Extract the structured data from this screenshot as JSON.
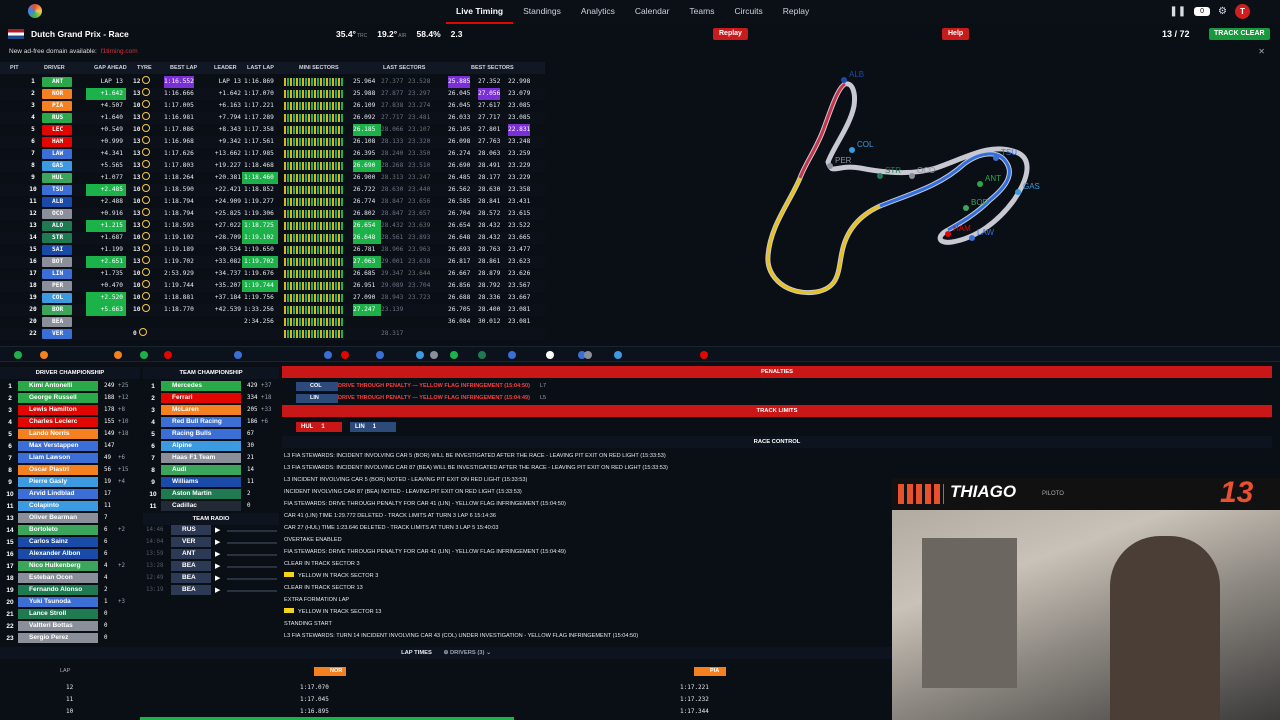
{
  "nav": {
    "items": [
      "Live Timing",
      "Standings",
      "Analytics",
      "Calendar",
      "Teams",
      "Circuits",
      "Replay"
    ],
    "active": "Live Timing"
  },
  "topright": {
    "notif_count": "0",
    "avatar": "T"
  },
  "race": {
    "title": "Dutch Grand Prix - Race",
    "track_temp": "35.4°",
    "air_temp": "19.2°",
    "humidity": "58.4%",
    "wind": "2.3",
    "replay_badge": "Replay",
    "help_badge": "Help",
    "lap_current": "13",
    "lap_total": "72",
    "track_status": "TRACK CLEAR"
  },
  "ad": {
    "text": "New ad-free domain available:",
    "link": "f1timing.com"
  },
  "timing_headers": {
    "pit": "PIT",
    "driver": "DRIVER",
    "gap": "GAP AHEAD",
    "tyre": "TYRE",
    "best": "BEST LAP",
    "leader": "LEADER",
    "last": "LAST LAP",
    "mini": "MINI SECTORS",
    "last_sectors": "LAST SECTORS",
    "best_sectors": "BEST SECTORS"
  },
  "timing": [
    {
      "pos": "1",
      "code": "ANT",
      "color": "#2aa84a",
      "gap": "LAP 13",
      "tyre": "12",
      "best": "1:16.552",
      "leader": "LAP 13",
      "last": "1:16.869",
      "s1": "25.964",
      "s2": "27.377",
      "s3": "23.528",
      "b1": "25.885",
      "b2": "27.352",
      "b3": "22.998"
    },
    {
      "pos": "2",
      "code": "NOR",
      "color": "#f58020",
      "gap": "+1.642",
      "gpb": true,
      "tyre": "13",
      "best": "1:16.666",
      "leader": "+1.642",
      "last": "1:17.070",
      "s1": "25.988",
      "s2": "27.877",
      "s3": "23.297",
      "b1": "26.045",
      "b2": "27.056",
      "b3": "23.079"
    },
    {
      "pos": "3",
      "code": "PIA",
      "color": "#f58020",
      "gap": "+4.507",
      "tyre": "10",
      "best": "1:17.005",
      "leader": "+6.163",
      "last": "1:17.221",
      "s1": "26.109",
      "s2": "27.838",
      "s3": "23.274",
      "b1": "26.045",
      "b2": "27.617",
      "b3": "23.085"
    },
    {
      "pos": "4",
      "code": "RUS",
      "color": "#2aa84a",
      "gap": "+1.640",
      "tyre": "13",
      "best": "1:16.981",
      "leader": "+7.794",
      "last": "1:17.289",
      "s1": "26.092",
      "s2": "27.717",
      "s3": "23.481",
      "b1": "26.033",
      "b2": "27.717",
      "b3": "23.085"
    },
    {
      "pos": "5",
      "code": "LEC",
      "color": "#e10600",
      "gap": "+0.549",
      "tyre": "10",
      "best": "1:17.086",
      "leader": "+8.343",
      "last": "1:17.358",
      "s1": "26.185",
      "s1pb": true,
      "s2": "28.066",
      "s3": "23.107",
      "b1": "26.105",
      "b2": "27.801",
      "b3": "22.831"
    },
    {
      "pos": "6",
      "code": "HAM",
      "color": "#e10600",
      "gap": "+0.999",
      "tyre": "13",
      "best": "1:16.968",
      "leader": "+9.342",
      "last": "1:17.561",
      "s1": "26.108",
      "s2": "28.133",
      "s3": "23.320",
      "b1": "26.098",
      "b2": "27.763",
      "b3": "23.248"
    },
    {
      "pos": "7",
      "code": "LAW",
      "color": "#3b6fd6",
      "gap": "+4.341",
      "tyre": "13",
      "best": "1:17.626",
      "leader": "+13.662",
      "last": "1:17.985",
      "s1": "26.395",
      "s2": "28.240",
      "s3": "23.350",
      "b1": "26.274",
      "b2": "28.063",
      "b3": "23.259"
    },
    {
      "pos": "8",
      "code": "GAS",
      "color": "#3b9ae0",
      "gap": "+5.565",
      "tyre": "13",
      "best": "1:17.803",
      "leader": "+19.227",
      "last": "1:18.468",
      "s1": "26.690",
      "s1pb": true,
      "s2": "28.268",
      "s3": "23.510",
      "b1": "26.690",
      "b2": "28.491",
      "b3": "23.229"
    },
    {
      "pos": "9",
      "code": "HUL",
      "color": "#3ba55c",
      "gap": "+1.077",
      "tyre": "13",
      "best": "1:18.264",
      "leader": "+20.381",
      "last": "1:18.460",
      "lpb": true,
      "s1": "26.900",
      "s2": "28.313",
      "s3": "23.247",
      "b1": "26.485",
      "b2": "28.177",
      "b3": "23.229"
    },
    {
      "pos": "10",
      "code": "TSU",
      "color": "#3b6fd6",
      "gap": "+2.485",
      "gpb": true,
      "tyre": "10",
      "best": "1:18.590",
      "leader": "+22.421",
      "last": "1:18.852",
      "s1": "26.722",
      "s2": "28.630",
      "s3": "23.440",
      "b1": "26.562",
      "b2": "28.630",
      "b3": "23.358"
    },
    {
      "pos": "11",
      "code": "ALB",
      "color": "#1a4ba8",
      "gap": "+2.488",
      "tyre": "10",
      "best": "1:18.794",
      "leader": "+24.909",
      "last": "1:19.277",
      "s1": "26.774",
      "s2": "28.847",
      "s3": "23.656",
      "b1": "26.585",
      "b2": "28.841",
      "b3": "23.431"
    },
    {
      "pos": "12",
      "code": "OCO",
      "color": "#8a8f99",
      "gap": "+0.916",
      "tyre": "13",
      "best": "1:18.794",
      "leader": "+25.825",
      "last": "1:19.306",
      "s1": "26.802",
      "s2": "28.847",
      "s3": "23.657",
      "b1": "26.704",
      "b2": "28.572",
      "b3": "23.615"
    },
    {
      "pos": "13",
      "code": "ALO",
      "color": "#1f7a52",
      "gap": "+1.215",
      "gpb": true,
      "tyre": "13",
      "best": "1:18.593",
      "leader": "+27.022",
      "last": "1:18.725",
      "lpb": true,
      "s1": "26.654",
      "s1pb": true,
      "s2": "28.432",
      "s3": "23.639",
      "b1": "26.654",
      "b2": "28.432",
      "b3": "23.522"
    },
    {
      "pos": "14",
      "code": "STR",
      "color": "#1f7a52",
      "gap": "+1.687",
      "tyre": "10",
      "best": "1:19.102",
      "leader": "+28.709",
      "last": "1:19.102",
      "lpb": true,
      "s1": "26.648",
      "s1pb": true,
      "s2": "28.561",
      "s3": "23.893",
      "b1": "26.648",
      "b2": "28.432",
      "b3": "23.665"
    },
    {
      "pos": "15",
      "code": "SAI",
      "color": "#1a4ba8",
      "gap": "+1.199",
      "tyre": "13",
      "best": "1:19.189",
      "leader": "+30.534",
      "last": "1:19.650",
      "s1": "26.781",
      "s2": "28.906",
      "s3": "23.963",
      "b1": "26.693",
      "b2": "28.763",
      "b3": "23.477"
    },
    {
      "pos": "16",
      "code": "BOT",
      "color": "#8a8f99",
      "gap": "+2.651",
      "gpb": true,
      "tyre": "13",
      "best": "1:19.702",
      "leader": "+33.082",
      "last": "1:19.702",
      "lpb": true,
      "s1": "27.063",
      "s1pb": true,
      "s2": "29.001",
      "s3": "23.638",
      "b1": "26.817",
      "b2": "28.861",
      "b3": "23.623"
    },
    {
      "pos": "17",
      "code": "LIN",
      "color": "#3b6fd6",
      "gap": "+1.735",
      "tyre": "10",
      "best": "2:53.929",
      "leader": "+34.737",
      "last": "1:19.676",
      "s1": "26.685",
      "s2": "29.347",
      "s3": "23.644",
      "b1": "26.667",
      "b2": "28.879",
      "b3": "23.626"
    },
    {
      "pos": "18",
      "code": "PER",
      "color": "#8a8f99",
      "gap": "+0.470",
      "tyre": "10",
      "best": "1:19.744",
      "leader": "+35.207",
      "last": "1:19.744",
      "lpb": true,
      "s1": "26.951",
      "s2": "29.089",
      "s3": "23.704",
      "b1": "26.856",
      "b2": "28.792",
      "b3": "23.567"
    },
    {
      "pos": "19",
      "code": "COL",
      "color": "#3b9ae0",
      "gap": "+2.520",
      "gpb": true,
      "tyre": "10",
      "best": "1:18.881",
      "leader": "+37.184",
      "last": "1:19.756",
      "s1": "27.090",
      "s2": "28.943",
      "s3": "23.723",
      "b1": "26.688",
      "b2": "28.336",
      "b3": "23.667"
    },
    {
      "pos": "20",
      "code": "BOR",
      "color": "#3ba55c",
      "gap": "+5.663",
      "gpb": true,
      "tyre": "10",
      "best": "1:18.770",
      "leader": "+42.539",
      "last": "1:33.256",
      "s1": "27.247",
      "s1pb": true,
      "s2": "23.139",
      "s3": "",
      "b1": "26.705",
      "b2": "28.400",
      "b3": "23.081"
    },
    {
      "pos": "20",
      "code": "BEA",
      "color": "#8a8f99",
      "gap": "",
      "tyre": "",
      "best": "",
      "leader": "",
      "last": "2:34.256",
      "s1": "",
      "s2": "",
      "s3": "",
      "b1": "36.084",
      "b2": "30.012",
      "b3": "23.081"
    },
    {
      "pos": "22",
      "code": "VER",
      "color": "#3b6fd6",
      "gap": "",
      "tyre": "0",
      "best": "",
      "leader": "",
      "last": "",
      "s1": "",
      "s2": "28.317",
      "s3": "",
      "b1": "",
      "b2": "",
      "b3": ""
    }
  ],
  "track_labels": [
    "ALB",
    "COL",
    "PER",
    "TSU",
    "STR",
    "OCO",
    "ANT",
    "GAS",
    "BOR",
    "HAM",
    "LAW"
  ],
  "driver_champ": {
    "title": "DRIVER CHAMPIONSHIP",
    "rows": [
      {
        "pos": "1",
        "name": "Kimi Antonelli",
        "color": "#2aa84a",
        "pts": "249",
        "chg": "+25"
      },
      {
        "pos": "2",
        "name": "George Russell",
        "color": "#2aa84a",
        "pts": "188",
        "chg": "+12"
      },
      {
        "pos": "3",
        "name": "Lewis Hamilton",
        "color": "#e10600",
        "pts": "178",
        "chg": "+8"
      },
      {
        "pos": "4",
        "name": "Charles Leclerc",
        "color": "#e10600",
        "pts": "155",
        "chg": "+10"
      },
      {
        "pos": "5",
        "name": "Lando Norris",
        "color": "#f58020",
        "pts": "149",
        "chg": "+18"
      },
      {
        "pos": "6",
        "name": "Max Verstappen",
        "color": "#3b6fd6",
        "pts": "147",
        "chg": ""
      },
      {
        "pos": "7",
        "name": "Liam Lawson",
        "color": "#3b6fd6",
        "pts": "49",
        "chg": "+6"
      },
      {
        "pos": "8",
        "name": "Oscar Piastri",
        "color": "#f58020",
        "pts": "56",
        "chg": "+15"
      },
      {
        "pos": "9",
        "name": "Pierre Gasly",
        "color": "#3b9ae0",
        "pts": "19",
        "chg": "+4"
      },
      {
        "pos": "10",
        "name": "Arvid Lindblad",
        "color": "#3b6fd6",
        "pts": "17",
        "chg": ""
      },
      {
        "pos": "11",
        "name": "Colapinto",
        "color": "#3b9ae0",
        "pts": "11",
        "chg": ""
      },
      {
        "pos": "13",
        "name": "Oliver Bearman",
        "color": "#8a8f99",
        "pts": "7",
        "chg": ""
      },
      {
        "pos": "14",
        "name": "Bortoleto",
        "color": "#3ba55c",
        "pts": "6",
        "chg": "+2"
      },
      {
        "pos": "15",
        "name": "Carlos Sainz",
        "color": "#1a4ba8",
        "pts": "6",
        "chg": ""
      },
      {
        "pos": "16",
        "name": "Alexander Albon",
        "color": "#1a4ba8",
        "pts": "6",
        "chg": ""
      },
      {
        "pos": "17",
        "name": "Nico Hulkenberg",
        "color": "#3ba55c",
        "pts": "4",
        "chg": "+2"
      },
      {
        "pos": "18",
        "name": "Esteban Ocon",
        "color": "#8a8f99",
        "pts": "4",
        "chg": ""
      },
      {
        "pos": "19",
        "name": "Fernando Alonso",
        "color": "#1f7a52",
        "pts": "2",
        "chg": ""
      },
      {
        "pos": "20",
        "name": "Yuki Tsunoda",
        "color": "#3b6fd6",
        "pts": "1",
        "chg": "+3"
      },
      {
        "pos": "21",
        "name": "Lance Stroll",
        "color": "#1f7a52",
        "pts": "0",
        "chg": ""
      },
      {
        "pos": "22",
        "name": "Valtteri Bottas",
        "color": "#8a8f99",
        "pts": "0",
        "chg": ""
      },
      {
        "pos": "23",
        "name": "Sergio Perez",
        "color": "#8a8f99",
        "pts": "0",
        "chg": ""
      }
    ]
  },
  "team_champ": {
    "title": "TEAM CHAMPIONSHIP",
    "rows": [
      {
        "pos": "1",
        "name": "Mercedes",
        "color": "#2aa84a",
        "pts": "429",
        "chg": "+37"
      },
      {
        "pos": "2",
        "name": "Ferrari",
        "color": "#e10600",
        "pts": "334",
        "chg": "+18"
      },
      {
        "pos": "3",
        "name": "McLaren",
        "color": "#f58020",
        "pts": "205",
        "chg": "+33"
      },
      {
        "pos": "4",
        "name": "Red Bull Racing",
        "color": "#3b6fd6",
        "pts": "186",
        "chg": "+6"
      },
      {
        "pos": "5",
        "name": "Racing Bulls",
        "color": "#3b6fd6",
        "pts": "67",
        "chg": ""
      },
      {
        "pos": "6",
        "name": "Alpine",
        "color": "#3b9ae0",
        "pts": "30",
        "chg": ""
      },
      {
        "pos": "7",
        "name": "Haas F1 Team",
        "color": "#8a8f99",
        "pts": "21",
        "chg": ""
      },
      {
        "pos": "8",
        "name": "Audi",
        "color": "#3ba55c",
        "pts": "14",
        "chg": ""
      },
      {
        "pos": "9",
        "name": "Williams",
        "color": "#1a4ba8",
        "pts": "11",
        "chg": ""
      },
      {
        "pos": "10",
        "name": "Aston Martin",
        "color": "#1f7a52",
        "pts": "2",
        "chg": ""
      },
      {
        "pos": "11",
        "name": "Cadillac",
        "color": "#222a36",
        "pts": "0",
        "chg": ""
      }
    ]
  },
  "team_radio": {
    "title": "TEAM RADIO",
    "rows": [
      {
        "time": "14:46",
        "code": "RUS"
      },
      {
        "time": "14:04",
        "code": "VER"
      },
      {
        "time": "13:59",
        "code": "ANT"
      },
      {
        "time": "13:28",
        "code": "BEA"
      },
      {
        "time": "12:49",
        "code": "BEA"
      },
      {
        "time": "13:19",
        "code": "BEA"
      }
    ]
  },
  "penalties": {
    "title": "PENALTIES",
    "rows": [
      {
        "code": "COL",
        "text": "DRIVE THROUGH PENALTY — YELLOW FLAG INFRINGEMENT (15:04:50)",
        "lap": "L7"
      },
      {
        "code": "LIN",
        "text": "DRIVE THROUGH PENALTY — YELLOW FLAG INFRINGEMENT (15:04:49)",
        "lap": "L5"
      }
    ]
  },
  "track_limits": {
    "title": "TRACK LIMITS",
    "chips": [
      {
        "code": "HUL",
        "count": "1"
      },
      {
        "code": "LIN",
        "count": "1"
      }
    ]
  },
  "race_control": {
    "title": "RACE CONTROL",
    "rows": [
      "L3  FIA STEWARDS: INCIDENT INVOLVING CAR 5 (BOR) WILL BE INVESTIGATED AFTER THE RACE - LEAVING PIT EXIT ON RED LIGHT (15:33:53)",
      "L3  FIA STEWARDS: INCIDENT INVOLVING CAR 87 (BEA) WILL BE INVESTIGATED AFTER THE RACE - LEAVING PIT EXIT ON RED LIGHT (15:33:53)",
      "L3  INCIDENT INVOLVING CAR 5 (BOR) NOTED - LEAVING PIT EXIT ON RED LIGHT (15:33:53)",
      "INCIDENT INVOLVING CAR 87 (BEA) NOTED - LEAVING PIT EXIT ON RED LIGHT (15:33:53)",
      "FIA STEWARDS: DRIVE THROUGH PENALTY FOR CAR 41 (LIN) - YELLOW FLAG INFRINGEMENT (15:04:50)",
      "CAR 41 (LIN) TIME 1:29.772 DELETED - TRACK LIMITS AT TURN 3 LAP 6 15:14:36",
      "CAR 27 (HUL) TIME 1:23.646 DELETED - TRACK LIMITS AT TURN 3 LAP 5 15:40:03",
      "OVERTAKE ENABLED",
      "FIA STEWARDS: DRIVE THROUGH PENALTY FOR CAR 41 (LIN) - YELLOW FLAG INFRINGEMENT (15:04:49)",
      "CLEAR IN TRACK SECTOR 3",
      "YELLOW IN TRACK SECTOR 3",
      "CLEAR IN TRACK SECTOR 13",
      "EXTRA FORMATION LAP",
      "YELLOW IN TRACK SECTOR 13",
      "STANDING START",
      "L3  FIA STEWARDS: TURN 14 INCIDENT INVOLVING CAR 43 (COL) UNDER INVESTIGATION - YELLOW FLAG INFRINGEMENT (15:04:50)"
    ]
  },
  "lap_times": {
    "title": "LAP TIMES",
    "drivers_label": "DRIVERS (3)",
    "lap_label": "LAP",
    "col1": "NOR",
    "col2": "PIA",
    "rows": [
      {
        "lap": "12",
        "t1": "1:17.070",
        "t2": "1:17.221"
      },
      {
        "lap": "11",
        "t1": "1:17.045",
        "t2": "1:17.232"
      },
      {
        "lap": "10",
        "t1": "1:16.895",
        "t2": "1:17.344"
      }
    ]
  },
  "streamer": {
    "name": "THIAGO",
    "sub": "PILOTO",
    "number": "13"
  },
  "colors": {
    "accent": "#e10600",
    "green": "#1cb24a",
    "purple": "#7b2fd6"
  }
}
